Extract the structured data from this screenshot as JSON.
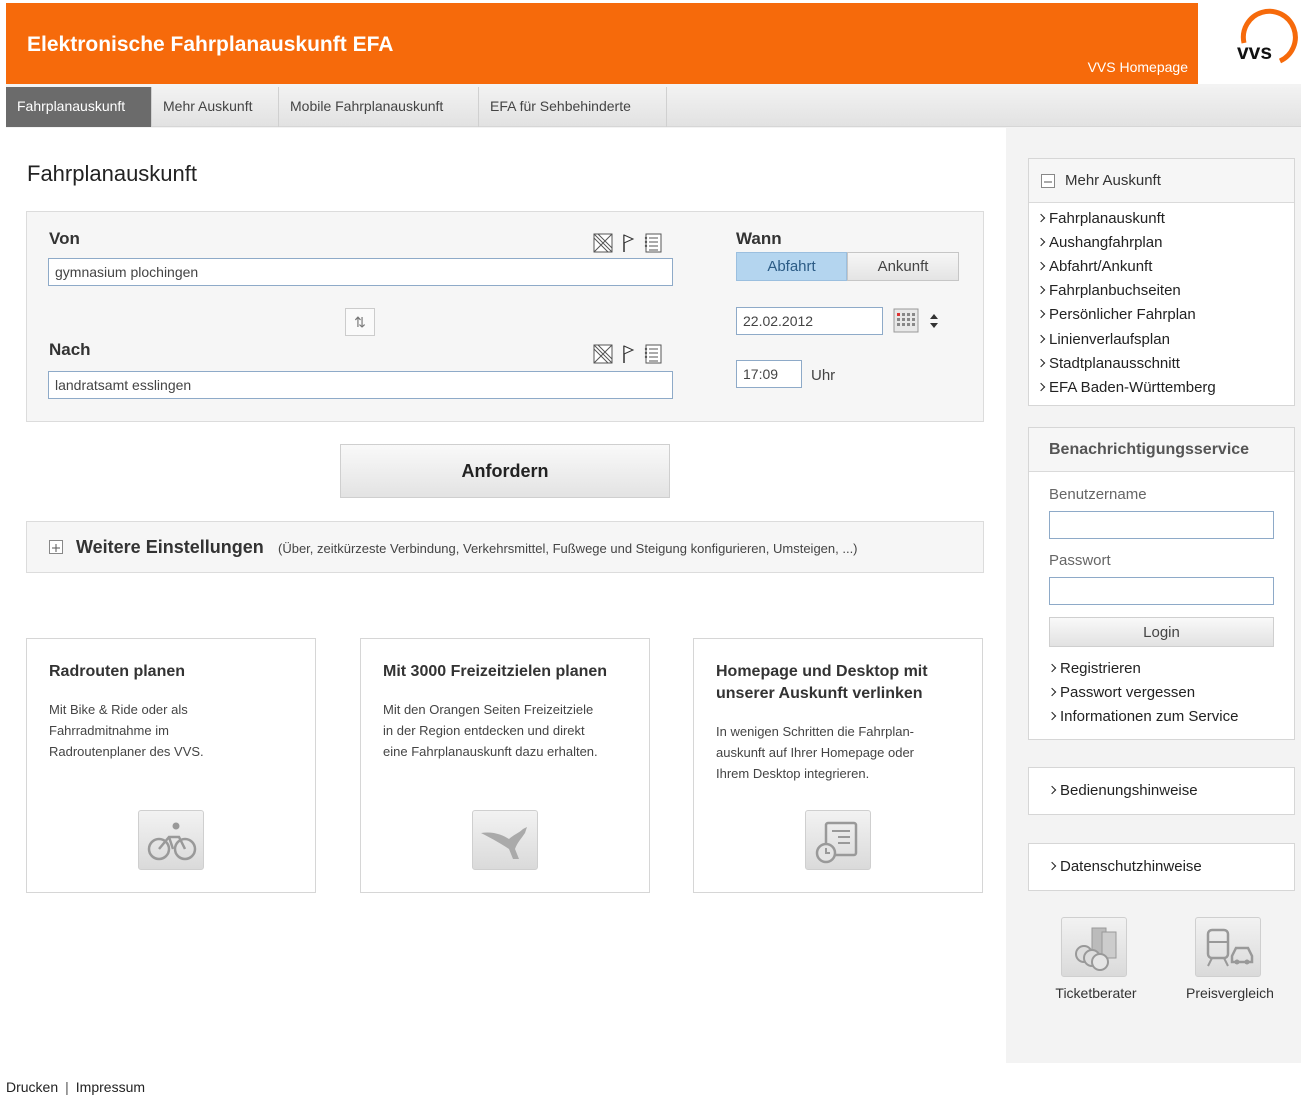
{
  "header": {
    "title": "Elektronische Fahrplanauskunft EFA",
    "homepage_link": "VVS Homepage",
    "logo_text": "vvs",
    "brand_color": "#f66a0b"
  },
  "nav": {
    "tabs": [
      {
        "label": "Fahrplanauskunft",
        "active": true
      },
      {
        "label": "Mehr Auskunft",
        "active": false
      },
      {
        "label": "Mobile Fahrplanauskunft",
        "active": false
      },
      {
        "label": "EFA für Sehbehinderte",
        "active": false
      }
    ]
  },
  "main": {
    "page_title": "Fahrplanauskunft",
    "form": {
      "von_label": "Von",
      "von_value": "gymnasium plochingen",
      "nach_label": "Nach",
      "nach_value": "landratsamt esslingen",
      "wann_label": "Wann",
      "abfahrt_label": "Abfahrt",
      "ankunft_label": "Ankunft",
      "date_value": "22.02.2012",
      "time_value": "17:09",
      "uhr_label": "Uhr",
      "icons": [
        "map-icon",
        "flag-icon",
        "list-icon"
      ]
    },
    "submit_label": "Anfordern",
    "weitere": {
      "title": "Weitere Einstellungen",
      "subtitle": "(Über, zeitkürzeste Verbindung, Verkehrsmittel, Fußwege und Steigung konfigurieren, Umsteigen, ...)"
    },
    "cards": [
      {
        "title": "Radrouten planen",
        "text": [
          "Mit Bike & Ride oder als",
          "Fahrradmitnahme im",
          "Radroutenplaner des VVS."
        ],
        "icon": "bicycle-icon"
      },
      {
        "title": "Mit 3000 Freizeitzielen planen",
        "text": [
          "Mit den Orangen Seiten Freizeitziele",
          "in der Region entdecken und direkt",
          "eine Fahrplanauskunft dazu erhalten."
        ],
        "icon": "kangaroo-icon"
      },
      {
        "title": "Homepage und Desktop mit unserer Auskunft verlinken",
        "text": [
          "In wenigen Schritten die Fahrplan-",
          "auskunft auf Ihrer Homepage oder",
          "Ihrem Desktop integrieren."
        ],
        "icon": "desktop-clock-icon"
      }
    ]
  },
  "sidebar": {
    "mehr_auskunft": {
      "title": "Mehr Auskunft",
      "links": [
        "Fahrplanauskunft",
        "Aushangfahrplan",
        "Abfahrt/Ankunft",
        "Fahrplanbuchseiten",
        "Persönlicher Fahrplan",
        "Linienverlaufsplan",
        "Stadtplanausschnitt",
        "EFA Baden-Württemberg"
      ]
    },
    "benachrichtigung": {
      "title": "Benachrichtigungsservice",
      "username_label": "Benutzername",
      "password_label": "Passwort",
      "login_label": "Login",
      "links": [
        "Registrieren",
        "Passwort vergessen",
        "Informationen zum Service"
      ]
    },
    "bedienungshinweise": "Bedienungshinweise",
    "datenschutzhinweise": "Datenschutzhinweise",
    "tools": [
      {
        "label": "Ticketberater",
        "icon": "ticket-coins-icon"
      },
      {
        "label": "Preisvergleich",
        "icon": "train-car-icon"
      }
    ]
  },
  "footer": {
    "print": "Drucken",
    "separator": "|",
    "imprint": "Impressum"
  }
}
